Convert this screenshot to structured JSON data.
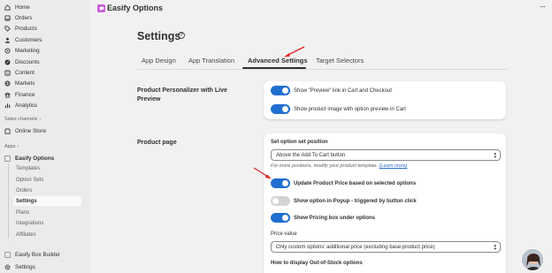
{
  "sidebar": {
    "items": [
      {
        "label": "Home"
      },
      {
        "label": "Orders"
      },
      {
        "label": "Products"
      },
      {
        "label": "Customers"
      },
      {
        "label": "Marketing"
      },
      {
        "label": "Discounts"
      },
      {
        "label": "Content"
      },
      {
        "label": "Markets"
      },
      {
        "label": "Finance"
      },
      {
        "label": "Analytics"
      }
    ],
    "sales_channels_label": "Sales channels",
    "online_store": "Online Store",
    "apps_label": "Apps",
    "easify_options": "Easify Options",
    "sub_items": [
      {
        "label": "Templates"
      },
      {
        "label": "Option Sets"
      },
      {
        "label": "Orders"
      },
      {
        "label": "Settings"
      },
      {
        "label": "Plans"
      },
      {
        "label": "Integrations"
      },
      {
        "label": "Affiliates"
      }
    ],
    "easify_box_builder": "Easify Box Builder",
    "settings": "Settings"
  },
  "header": {
    "app_title": "Easify Options",
    "more": "···"
  },
  "main": {
    "title": "Settings",
    "help": "?",
    "tabs": [
      {
        "label": "App Design"
      },
      {
        "label": "App Translation"
      },
      {
        "label": "Advanced Settings"
      },
      {
        "label": "Target Selectors"
      }
    ],
    "personalizer": {
      "heading": "Product Personalizer with Live Preview",
      "toggles": [
        {
          "label": "Show \"Preview\" link in Cart and Checkout",
          "on": true
        },
        {
          "label": "Show product image with option preview in Cart",
          "on": true
        }
      ]
    },
    "product_page": {
      "heading": "Product page",
      "position_label": "Set option set position",
      "position_value": "Above the Add To Cart button",
      "hint_text": "For more positions, modify your product template.",
      "hint_link": "(Learn more)",
      "toggles": [
        {
          "label": "Update Product Price based on selected options",
          "on": true
        },
        {
          "label": "Show option in Popup - triggered by button click",
          "on": false
        },
        {
          "label": "Show Pricing box under options",
          "on": true
        }
      ],
      "price_value_label": "Price value",
      "price_value": "Only custom options' additional price (excluding base product price)",
      "oos_label": "How to display Out-of-Stock options"
    }
  },
  "colors": {
    "accent": "#1f6fd0",
    "annotation_arrow": "#e02424",
    "app_icon": "#c85bd9"
  }
}
